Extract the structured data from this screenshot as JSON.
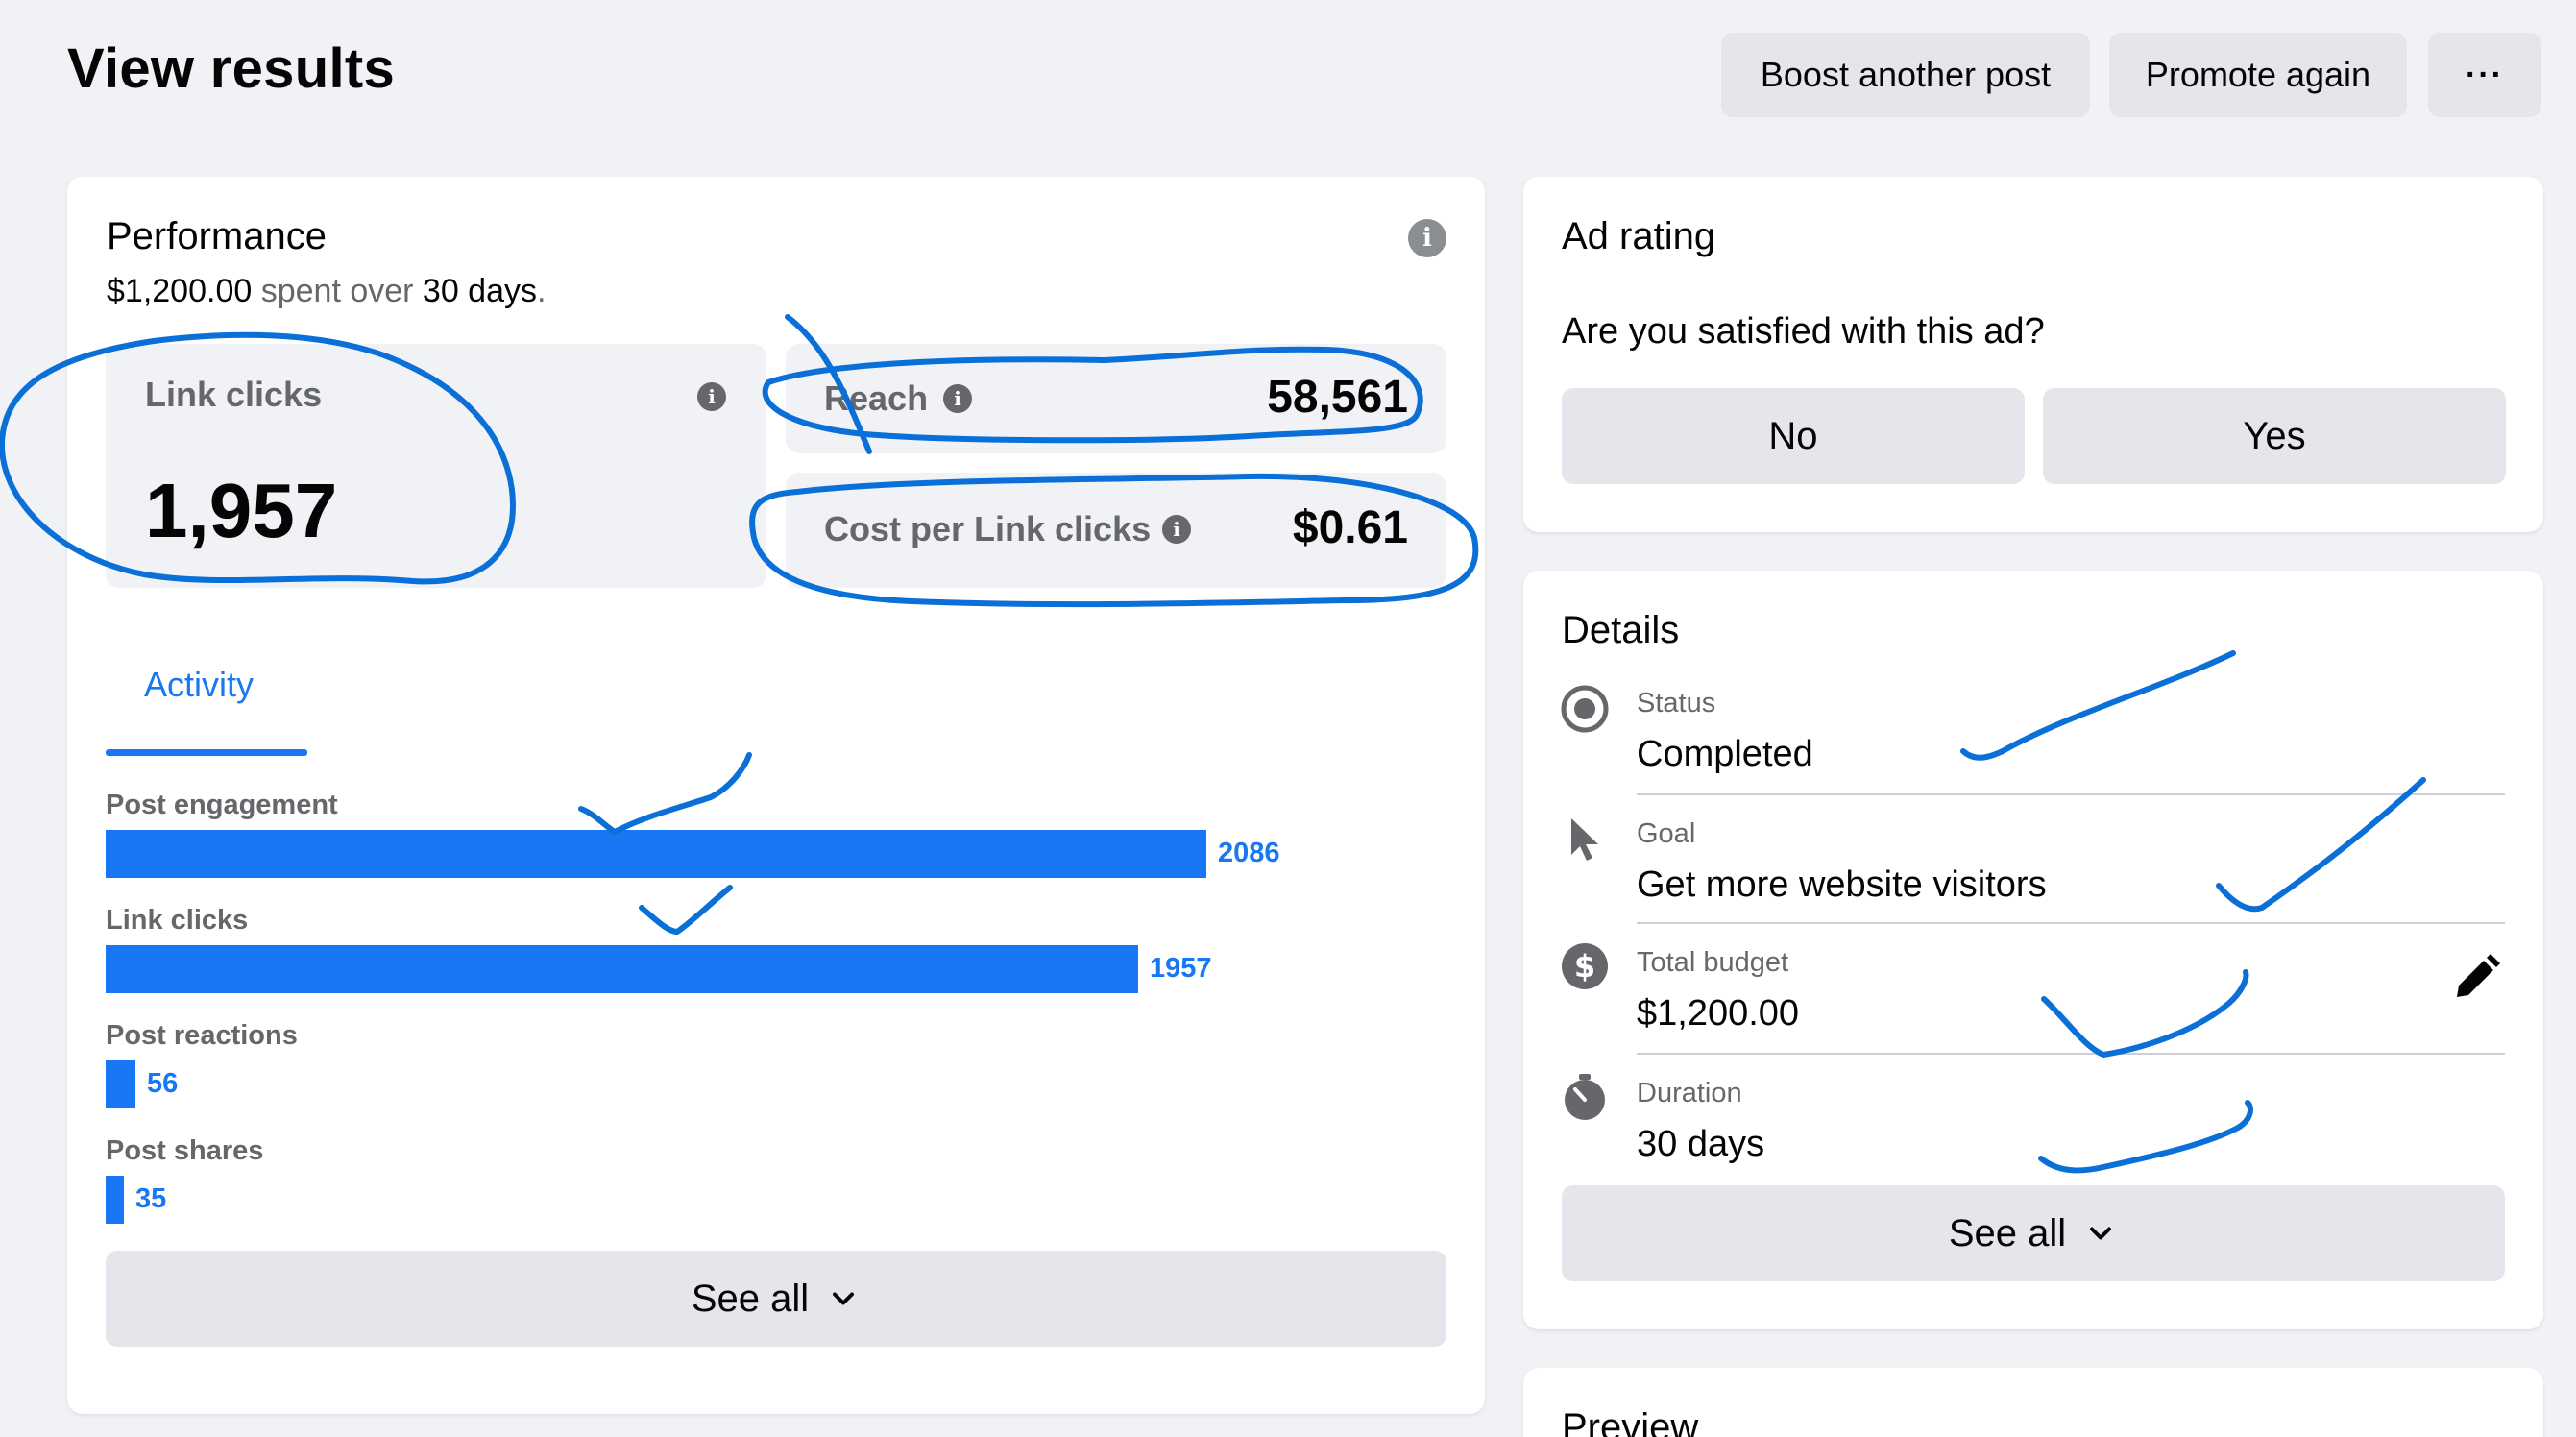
{
  "header": {
    "title": "View results",
    "boost_label": "Boost another post",
    "promote_label": "Promote again",
    "more_label": "···"
  },
  "performance": {
    "title": "Performance",
    "spent_amount": "$1,200.00",
    "spent_mid": " spent over ",
    "spent_days": "30 days",
    "spent_end": ".",
    "link_clicks_label": "Link clicks",
    "link_clicks_value": "1,957",
    "reach_label": "Reach",
    "reach_value": "58,561",
    "cpc_label": "Cost per Link clicks",
    "cpc_value": "$0.61",
    "activity_tab": "Activity",
    "see_all": "See all"
  },
  "activity": {
    "max": 2086,
    "items": [
      {
        "label": "Post engagement",
        "value": 2086
      },
      {
        "label": "Link clicks",
        "value": 1957
      },
      {
        "label": "Post reactions",
        "value": 56
      },
      {
        "label": "Post shares",
        "value": 35
      }
    ]
  },
  "ad_rating": {
    "title": "Ad rating",
    "question": "Are you satisfied with this ad?",
    "no_label": "No",
    "yes_label": "Yes"
  },
  "details": {
    "title": "Details",
    "items": [
      {
        "label": "Status",
        "value": "Completed",
        "icon": "radio-icon"
      },
      {
        "label": "Goal",
        "value": "Get more website visitors",
        "icon": "cursor-icon"
      },
      {
        "label": "Total budget",
        "value": "$1,200.00",
        "icon": "dollar-icon"
      },
      {
        "label": "Duration",
        "value": "30 days",
        "icon": "stopwatch-icon"
      }
    ],
    "see_all": "See all"
  },
  "preview": {
    "title": "Preview"
  },
  "colors": {
    "accent": "#1877f2",
    "annotation": "#0a6fd6",
    "background": "#f0f2f5"
  }
}
